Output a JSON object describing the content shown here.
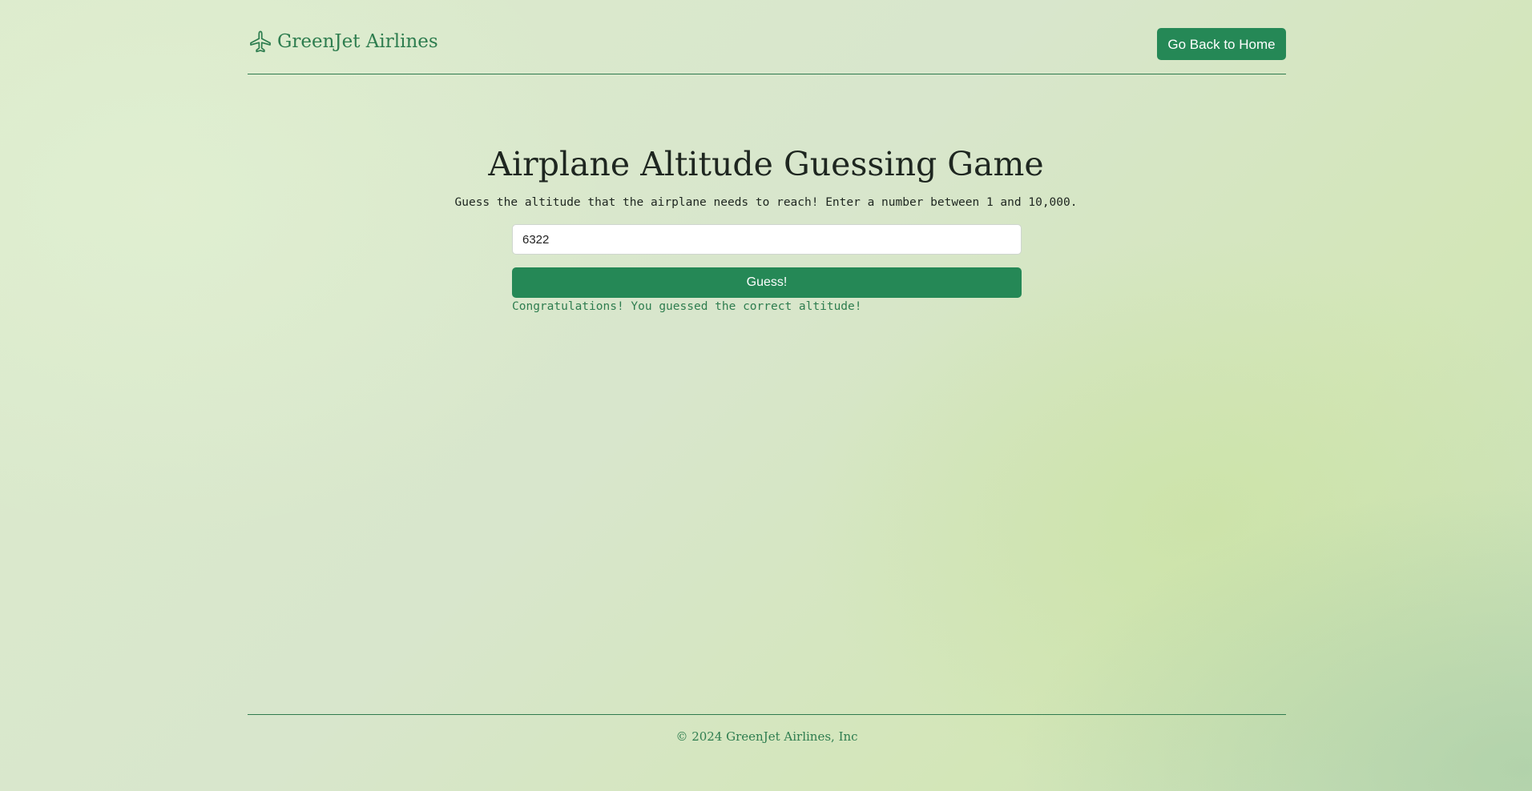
{
  "header": {
    "brand_name": "GreenJet Airlines",
    "brand_icon": "airplane-icon",
    "home_button_label": "Go Back to Home"
  },
  "game": {
    "title": "Airplane Altitude Guessing Game",
    "instructions": "Guess the altitude that the airplane needs to reach! Enter a number between 1 and 10,000.",
    "input_value": "6322",
    "guess_button_label": "Guess!",
    "result_message": "Congratulations! You guessed the correct altitude!"
  },
  "footer": {
    "copyright": "© 2024 GreenJet Airlines, Inc"
  },
  "colors": {
    "accent": "#258856",
    "brand_text": "#2e7d4f",
    "success_text": "#2e7d4f"
  }
}
